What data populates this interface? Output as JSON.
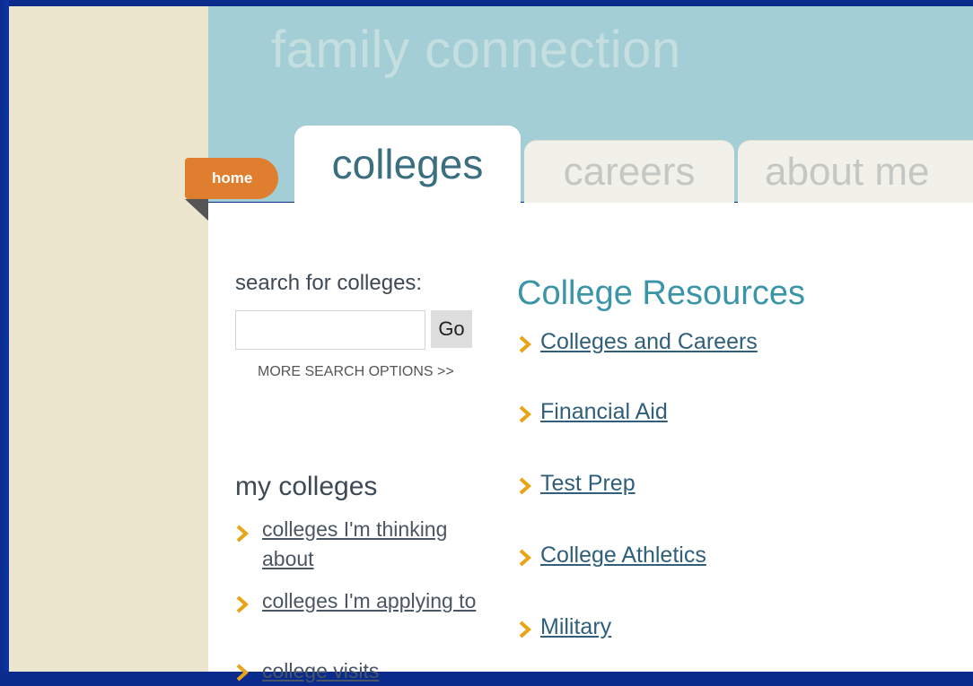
{
  "app": {
    "logo_text": "family connection"
  },
  "nav": {
    "home_label": "home",
    "tabs": [
      {
        "label": "colleges",
        "active": true
      },
      {
        "label": "careers",
        "active": false
      },
      {
        "label": "about me",
        "active": false
      }
    ]
  },
  "search": {
    "label": "search for colleges:",
    "value": "",
    "placeholder": "",
    "go_label": "Go",
    "more_options": "MORE SEARCH OPTIONS >>"
  },
  "my_colleges": {
    "title": "my colleges",
    "items": [
      {
        "label": "colleges I'm thinking about"
      },
      {
        "label": "colleges I'm applying to"
      },
      {
        "label": "college visits"
      }
    ]
  },
  "resources": {
    "title": "College Resources",
    "items": [
      {
        "label": "Colleges and Careers"
      },
      {
        "label": "Financial Aid"
      },
      {
        "label": "Test Prep"
      },
      {
        "label": "College Athletics"
      },
      {
        "label": "Military"
      }
    ]
  },
  "colors": {
    "accent_orange": "#e07e2f",
    "arrow_gold": "#e8a317",
    "header_teal": "#a3ced6",
    "title_teal": "#3a95a8"
  }
}
